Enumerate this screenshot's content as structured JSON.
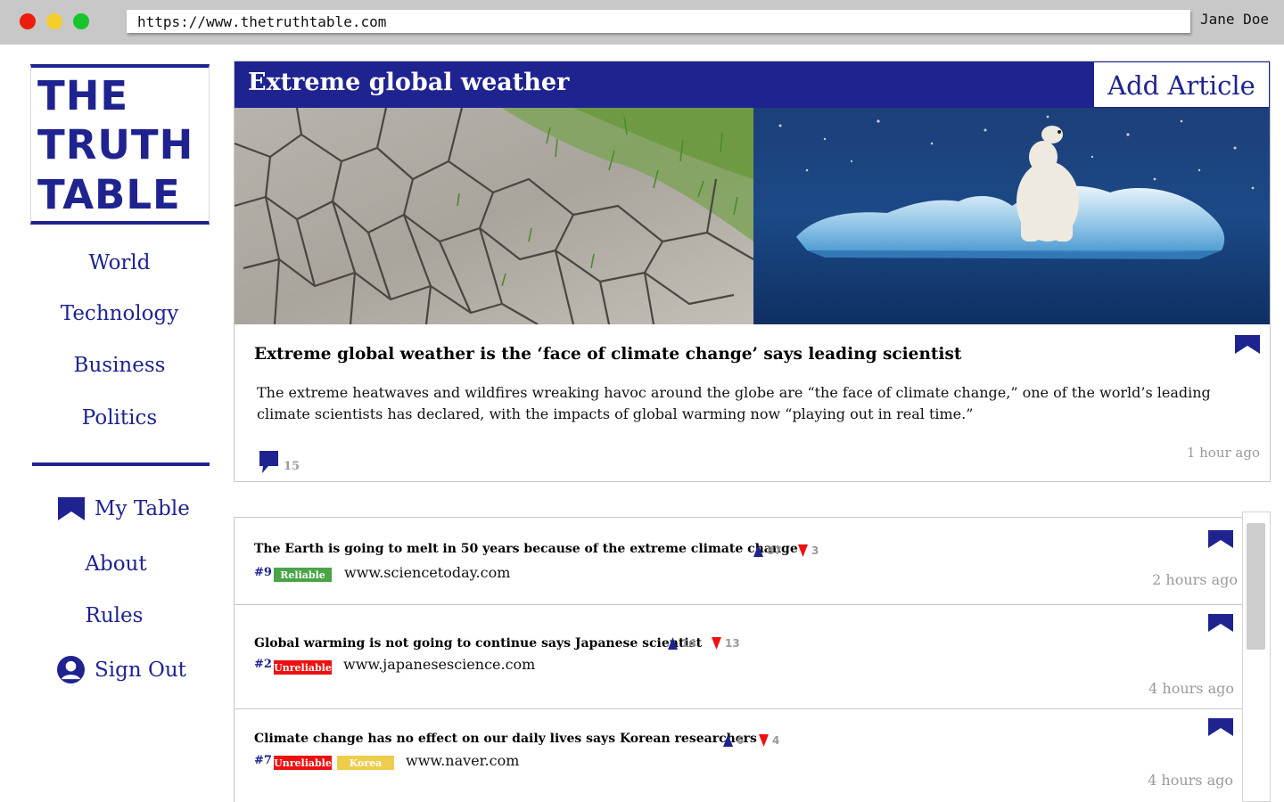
{
  "browser": {
    "url": "https://www.thetruthtable.com",
    "user": "Jane Doe"
  },
  "logo": {
    "lines": [
      "THE",
      "TRUTH",
      "TABLE"
    ]
  },
  "nav": {
    "world": "World",
    "technology": "Technology",
    "business": "Business",
    "politics": "Politics",
    "my_table": "My Table",
    "about": "About",
    "rules": "Rules",
    "sign_out": "Sign Out"
  },
  "feature": {
    "section_title": "Extreme global weather",
    "add_article": "Add Article",
    "headline": "Extreme global weather is the ‘face of climate change’ says leading scientist",
    "body": "The extreme heatwaves and wildfires wreaking havoc around the globe are “the face of climate change,” one of the world’s leading climate scientists has declared, with the impacts of global warming now “playing out in real time.”",
    "comments": "15",
    "time": "1 hour ago"
  },
  "articles": [
    {
      "title": "The Earth is going to melt in 50 years because of the extreme climate change",
      "up": "87",
      "down": "3",
      "rank": "#9",
      "badges": [
        "Reliable"
      ],
      "source": "www.sciencetoday.com",
      "time": "2 hours ago"
    },
    {
      "title": "Global warming is not going to continue says Japanese scientist",
      "up": "14",
      "down": "13",
      "rank": "#2",
      "badges": [
        "Unreliable"
      ],
      "source": "www.japanesescience.com",
      "time": "4 hours ago"
    },
    {
      "title": "Climate change has no effect on our daily lives says Korean researchers",
      "up": "6",
      "down": "4",
      "rank": "#7",
      "badges": [
        "Unreliable",
        "Korea"
      ],
      "source": "www.naver.com",
      "time": "4 hours ago"
    }
  ],
  "colors": {
    "brand": "#1f2390",
    "reliable": "#4aa448",
    "unreliable": "#ee1010",
    "tag": "#eecc4c",
    "muted": "#9a9a9a"
  },
  "icons": {
    "bookmark": "bookmark-icon",
    "comment": "comment-icon",
    "upvote": "upvote-arrow-icon",
    "downvote": "downvote-arrow-icon",
    "user": "user-icon"
  }
}
